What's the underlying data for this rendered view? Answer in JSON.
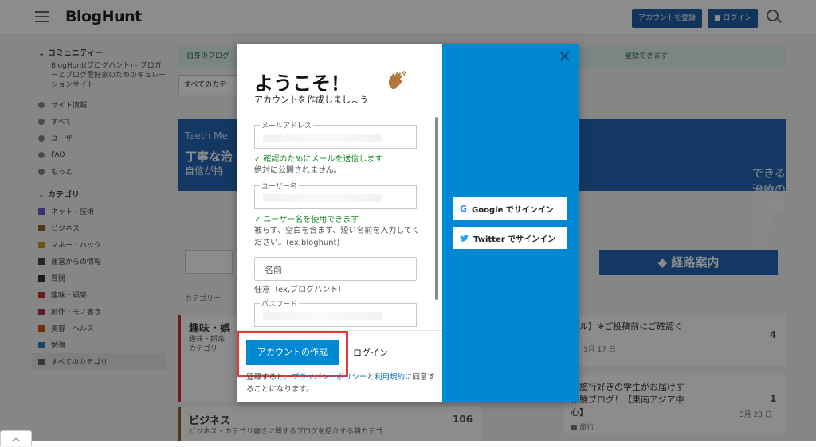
{
  "header": {
    "logo": "BlogHunt",
    "signup_label": "アカウントを登録",
    "login_label": "ログイン"
  },
  "sidebar": {
    "community_head": "コミュニティー",
    "community_desc": "BlogHunt(ブログハント) - ブロガーとブログ愛好家のためのキュレーションサイト",
    "nav_items": [
      {
        "label": "サイト情報"
      },
      {
        "label": "すべて"
      },
      {
        "label": "ユーザー"
      },
      {
        "label": "FAQ"
      },
      {
        "label": "もっと"
      }
    ],
    "category_head": "カテゴリ",
    "categories": [
      {
        "label": "ネット・技術",
        "color": "#6a5acd"
      },
      {
        "label": "ビジネス",
        "color": "#8b6a2b"
      },
      {
        "label": "マネー・ハック",
        "color": "#c0a020"
      },
      {
        "label": "運営からの情報",
        "color": "#444444"
      },
      {
        "label": "質問",
        "color": "#333333"
      },
      {
        "label": "趣味・娯楽",
        "color": "#c0392b"
      },
      {
        "label": "創作・モノ書き",
        "color": "#b03060"
      },
      {
        "label": "美容・ヘルス",
        "color": "#d35400"
      },
      {
        "label": "勉強",
        "color": "#2980b9"
      },
      {
        "label": "すべてのカテゴリ",
        "color": "#666666"
      }
    ]
  },
  "background": {
    "banner_text": "自身のブログ",
    "banner_text_right": "登録できます",
    "select_value": "すべてのカテ",
    "ad_line1": "Teeth Me",
    "ad_line2": "丁寧な治",
    "ad_line3": "自信が持",
    "ad_line4": "できる治療の提案致します。",
    "route_button": "経路案内",
    "category_label": "カテゴリー",
    "card1_title": "趣味・娯",
    "card1_sub": "趣味・娯楽",
    "card1_sub2": "カテゴリー",
    "card2_title": "ビジネス",
    "card2_sub": "ビジネス・カテゴリ書きに関するブログを紹介する親カテゴ",
    "card2_count": "106",
    "post1_title": "ール】※ご投稿前にご確認く",
    "post1_count": "4",
    "post1_date": "3月 17 日",
    "post2_title": "】旅行好きの学生がお届けす",
    "post2_title2": "体験ブログ！【東南アジア中",
    "post2_title3": "心】",
    "post2_count": "1",
    "post2_date": "3月 23 日",
    "post2_tag": "旅行"
  },
  "modal": {
    "title": "ようこそ！",
    "subtitle": "アカウントを作成しましょう",
    "email_label": "メールアドレス",
    "email_ok": "確認のためにメールを送信します",
    "email_hint": "絶対に公開されません。",
    "username_label": "ユーザー名",
    "username_ok": "ユーザー名を使用できます",
    "username_hint": "被らず、空白を含まず、短い名前を入力してください。(ex,bloghunt)",
    "name_placeholder": "名前",
    "name_hint": "任意（ex,ブログハント）",
    "password_label": "パスワード",
    "create_button": "アカウントの作成",
    "login_link": "ログイン",
    "terms_prefix": "登録すると、",
    "privacy_link": "プライバシーポリシー",
    "terms_and": "と",
    "terms_link": "利用規約",
    "terms_suffix": "に同意することになります。",
    "google_button": "Google でサインイン",
    "twitter_button": "Twitter でサインイン"
  },
  "colors": {
    "accent": "#0088d2",
    "highlight": "#e53935",
    "success": "#1a8a2a"
  }
}
